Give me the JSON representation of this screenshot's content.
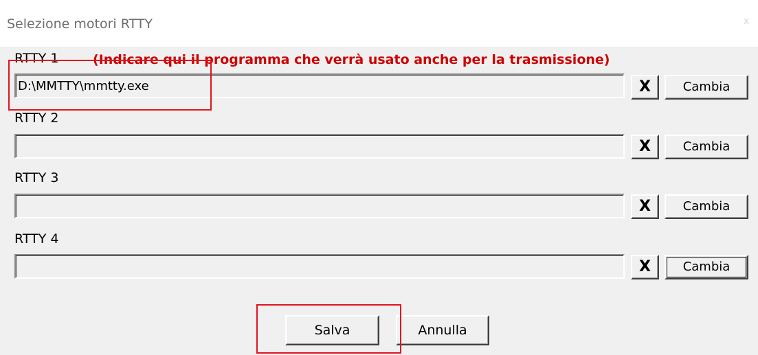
{
  "window": {
    "title": "Selezione motori RTTY",
    "close_glyph": "x"
  },
  "rows": [
    {
      "label": "RTTY 1",
      "path": "D:\\MMTTY\\mmtty.exe",
      "clear_glyph": "X",
      "change_label": "Cambia"
    },
    {
      "label": "RTTY 2",
      "path": "",
      "clear_glyph": "X",
      "change_label": "Cambia"
    },
    {
      "label": "RTTY 3",
      "path": "",
      "clear_glyph": "X",
      "change_label": "Cambia"
    },
    {
      "label": "RTTY 4",
      "path": "",
      "clear_glyph": "X",
      "change_label": "Cambia"
    }
  ],
  "note": "(Indicare qui il programma che verrà usato anche per la trasmissione)",
  "buttons": {
    "save": "Salva",
    "cancel": "Annulla"
  },
  "colors": {
    "note": "#cc0000",
    "highlight": "#e0141e",
    "background": "#f0f0f0"
  }
}
